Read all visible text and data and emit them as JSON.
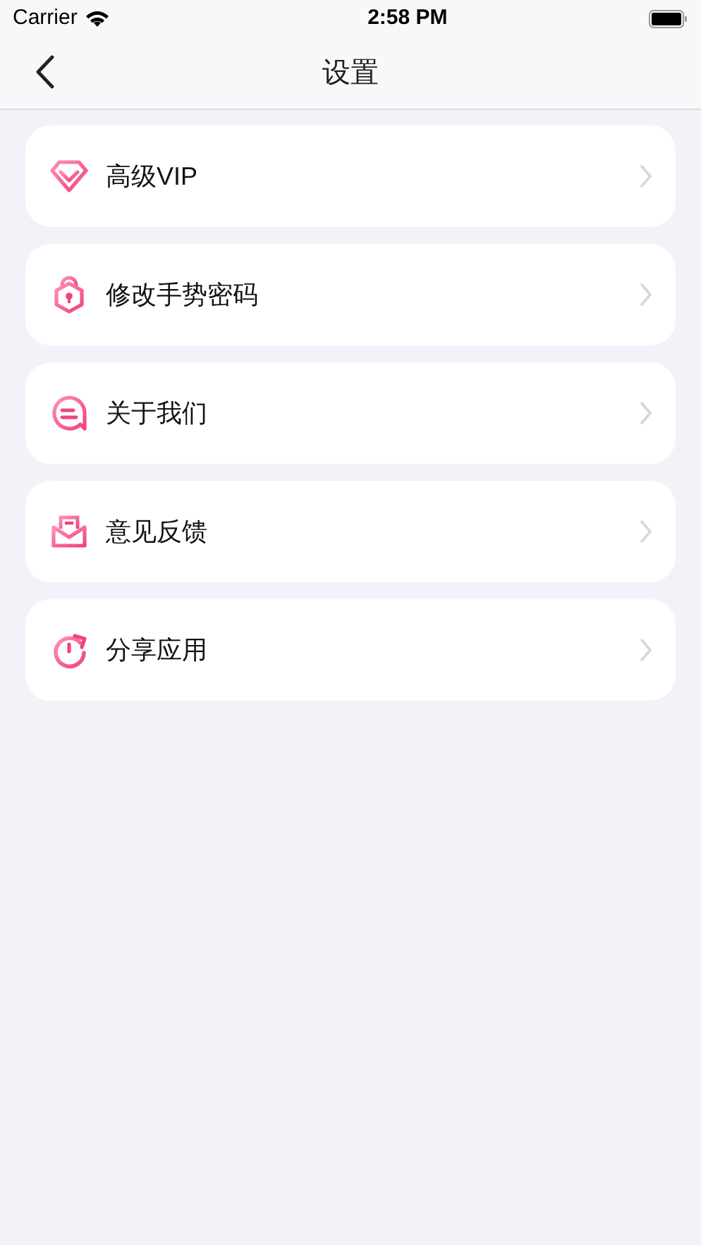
{
  "status_bar": {
    "carrier": "Carrier",
    "time": "2:58 PM"
  },
  "nav": {
    "title": "设置"
  },
  "items": [
    {
      "kind": "vip",
      "label": "高级VIP"
    },
    {
      "kind": "lock",
      "label": "修改手势密码"
    },
    {
      "kind": "chat",
      "label": "关于我们"
    },
    {
      "kind": "mail",
      "label": "意见反馈"
    },
    {
      "kind": "share",
      "label": "分享应用"
    }
  ]
}
